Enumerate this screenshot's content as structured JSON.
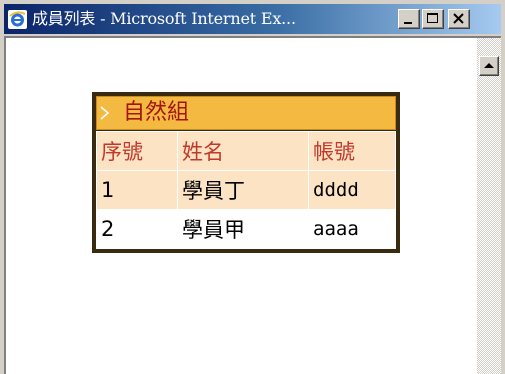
{
  "window": {
    "title": "成員列表 - Microsoft Internet Ex..."
  },
  "group": {
    "title": "自然組"
  },
  "table": {
    "headers": [
      "序號",
      "姓名",
      "帳號"
    ],
    "rows": [
      [
        "1",
        "學員丁",
        "dddd"
      ],
      [
        "2",
        "學員甲",
        "aaaa"
      ]
    ]
  },
  "colors": {
    "header_bar": "#f4b940",
    "header_text": "#c0392b",
    "row_alt": "#fbe3c4",
    "titlebar_start": "#0a246a",
    "titlebar_end": "#a6caf0"
  },
  "icons": {
    "title": "internet-explorer-icon",
    "minimize": "minimize-icon",
    "maximize": "maximize-icon",
    "close": "close-icon",
    "scroll_up": "scroll-up-arrow-icon",
    "group": "chevron-right-icon"
  }
}
